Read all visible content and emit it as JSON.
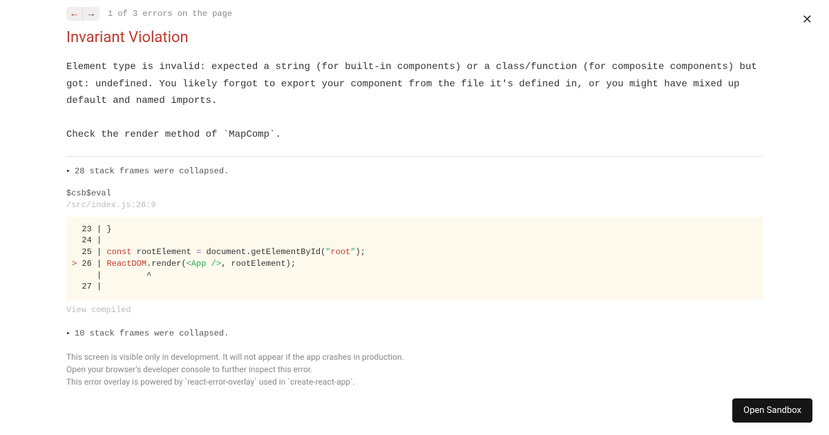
{
  "nav": {
    "counter": "1 of 3 errors on the page"
  },
  "error": {
    "title": "Invariant Violation",
    "message": "Element type is invalid: expected a string (for built-in components) or a class/function (for composite components) but got: undefined. You likely forgot to export your component from the file it's defined in, or you might have mixed up default and named imports.\n\nCheck the render method of `MapComp`."
  },
  "frames": {
    "collapsed1": "28 stack frames were collapsed.",
    "name": "$csb$eval",
    "location": "/src/index.js:26:9",
    "collapsed2": "10 stack frames were collapsed.",
    "view_compiled": "View compiled"
  },
  "code": {
    "l23": "  23 | }",
    "l24": "  24 | ",
    "l25_pre": "  25 | ",
    "l25_kw": "const",
    "l25_mid": " rootElement ",
    "l25_op": "=",
    "l25_post": " document.getElementById(",
    "l25_q1": "\"",
    "l25_str": "root",
    "l25_q2": "\"",
    "l25_end": ");",
    "l26_caret": ">",
    "l26_pre": " 26 | ",
    "l26_rd": "ReactDOM",
    "l26_render": ".render(",
    "l26_jsx": "<App />",
    "l26_end": ", rootElement);",
    "l26p": "     |         ^",
    "l27": "  27 | "
  },
  "footer": {
    "l1": "This screen is visible only in development. It will not appear if the app crashes in production.",
    "l2": "Open your browser's developer console to further inspect this error.",
    "l3": "This error overlay is powered by `react-error-overlay` used in `create-react-app`."
  },
  "sandbox_btn": "Open Sandbox"
}
